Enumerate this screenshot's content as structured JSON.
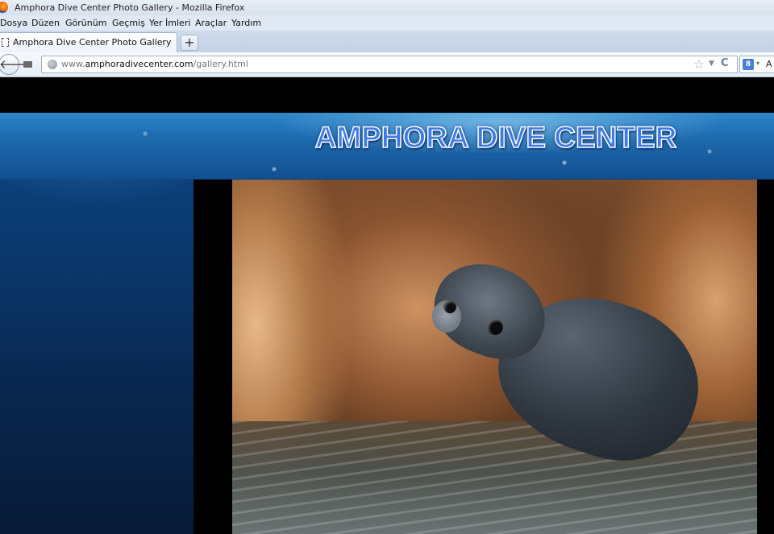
{
  "window": {
    "title": "Amphora Dive Center Photo Gallery - Mozilla Firefox"
  },
  "menu": [
    {
      "label": "Dosya"
    },
    {
      "label": "Düzen"
    },
    {
      "label": "Görünüm"
    },
    {
      "label": "Geçmiş"
    },
    {
      "label": "Yer İmleri"
    },
    {
      "label": "Araçlar"
    },
    {
      "label": "Yardım"
    }
  ],
  "tabs": [
    {
      "label": "Amphora Dive Center Photo Gallery",
      "active": true
    }
  ],
  "new_tab": {
    "label": "+"
  },
  "navigation": {
    "back_label": "🡐",
    "url_prefix": "www.",
    "url_domain": "amphoradivecenter.com",
    "url_path": "/gallery.html",
    "reload_label": "C"
  },
  "search": {
    "engine_label": "8",
    "value": "A"
  },
  "page": {
    "banner_title": "AMPHORA DIVE CENTER"
  },
  "colors": {
    "banner_text": "#3d7be8",
    "page_background": "#0b3a70"
  },
  "icons": {
    "back": "back-arrow-icon",
    "site": "globe-icon",
    "bookmark": "star-icon",
    "reload": "reload-icon",
    "search_engine": "google-icon"
  }
}
